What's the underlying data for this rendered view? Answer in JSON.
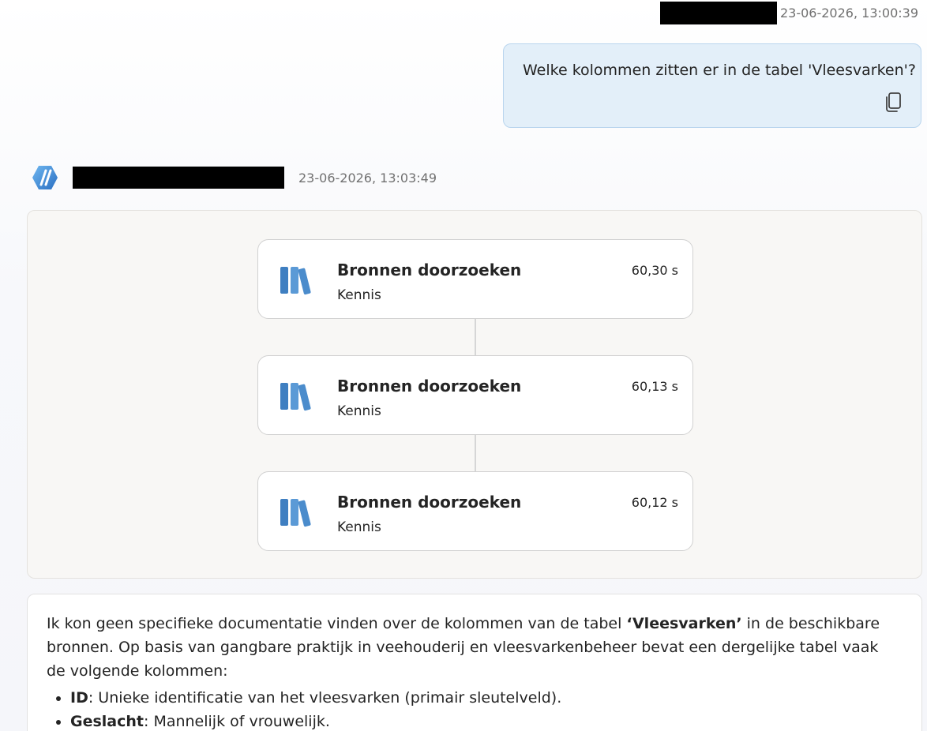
{
  "user_message": {
    "timestamp": "23-06-2026, 13:00:39",
    "text": "Welke kolommen zitten er in de tabel 'Vleesvarken'?",
    "copy_icon": "copy-icon"
  },
  "bot_message": {
    "timestamp": "23-06-2026, 13:03:49",
    "avatar_icon": "copilot-logo-icon"
  },
  "activity": {
    "steps": [
      {
        "title": "Bronnen doorzoeken",
        "subtitle": "Kennis",
        "duration": "60,30 s",
        "icon": "books-icon"
      },
      {
        "title": "Bronnen doorzoeken",
        "subtitle": "Kennis",
        "duration": "60,13 s",
        "icon": "books-icon"
      },
      {
        "title": "Bronnen doorzoeken",
        "subtitle": "Kennis",
        "duration": "60,12 s",
        "icon": "books-icon"
      }
    ]
  },
  "answer": {
    "intro_before": "Ik kon geen specifieke documentatie vinden over de kolommen van de tabel ",
    "intro_bold": "‘Vleesvarken’",
    "intro_after": " in de beschikbare bronnen. Op basis van gangbare praktijk in veehouderij en vleesvarkenbeheer bevat een dergelijke tabel vaak de volgende kolommen:",
    "items": [
      {
        "term": "ID",
        "desc": ": Unieke identificatie van het vleesvarken (primair sleutelveld)."
      },
      {
        "term": "Geslacht",
        "desc": ": Mannelijk of vrouwelijk."
      }
    ]
  },
  "colors": {
    "user_bubble_bg": "#e3eff9",
    "user_bubble_border": "#b9d5ee",
    "activity_bg": "#f8f7f5",
    "book_blue": "#3f7fc1",
    "timestamp_gray": "#707070"
  }
}
